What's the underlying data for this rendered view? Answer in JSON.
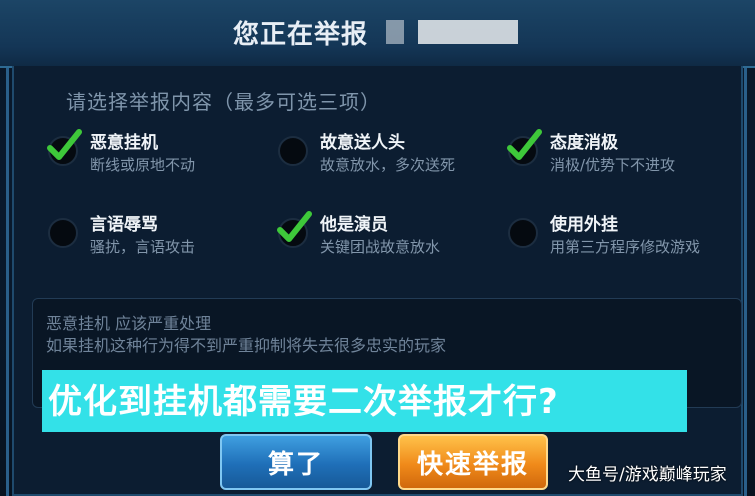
{
  "dialog": {
    "title": "您正在举报",
    "subtitle": "请选择举报内容（最多可选三项）"
  },
  "options": [
    {
      "title": "恶意挂机",
      "desc": "断线或原地不动",
      "checked": true
    },
    {
      "title": "故意送人头",
      "desc": "故意放水，多次送死",
      "checked": false
    },
    {
      "title": "态度消极",
      "desc": "消极/优势下不进攻",
      "checked": true
    },
    {
      "title": "言语辱骂",
      "desc": "骚扰，言语攻击",
      "checked": false
    },
    {
      "title": "他是演员",
      "desc": "关键团战故意放水",
      "checked": true
    },
    {
      "title": "使用外挂",
      "desc": "用第三方程序修改游戏",
      "checked": false
    }
  ],
  "comment": {
    "line1": "恶意挂机 应该严重处理",
    "line2": "如果挂机这种行为得不到严重抑制将失去很多忠实的玩家"
  },
  "banner": {
    "text": "优化到挂机都需要二次举报才行?"
  },
  "buttons": {
    "cancel": "算了",
    "report": "快速举报"
  },
  "watermark": "大鱼号/游戏巅峰玩家",
  "colors": {
    "check": "#3ec83a",
    "banner_bg": "#33e1e8",
    "report_btn": "#f08a1a",
    "cancel_btn": "#1f6fb8"
  }
}
